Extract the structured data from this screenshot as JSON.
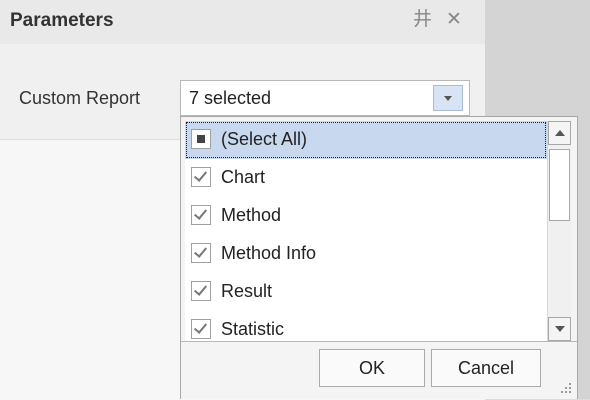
{
  "panel": {
    "title": "Parameters",
    "pin_glyph": "井",
    "close_glyph": "✕"
  },
  "parameter": {
    "label": "Custom Report",
    "combo_value": "7 selected"
  },
  "dropdown": {
    "items": [
      {
        "label": "(Select All)",
        "state": "indeterminate",
        "selected": true
      },
      {
        "label": "Chart",
        "state": "checked",
        "selected": false
      },
      {
        "label": "Method",
        "state": "checked",
        "selected": false
      },
      {
        "label": "Method Info",
        "state": "checked",
        "selected": false
      },
      {
        "label": "Result",
        "state": "checked",
        "selected": false
      },
      {
        "label": "Statistic",
        "state": "checked",
        "selected": false
      }
    ],
    "ok_label": "OK",
    "cancel_label": "Cancel"
  },
  "icons": {
    "pin": "pin-icon",
    "close": "close-icon",
    "dropdown": "chevron-down-icon",
    "scroll_up": "scroll-up-arrow-icon",
    "scroll_down": "scroll-down-arrow-icon",
    "resize": "resize-grip-icon"
  },
  "colors": {
    "selection": "#c8d8ef",
    "combo_button": "#d8e4f4"
  }
}
